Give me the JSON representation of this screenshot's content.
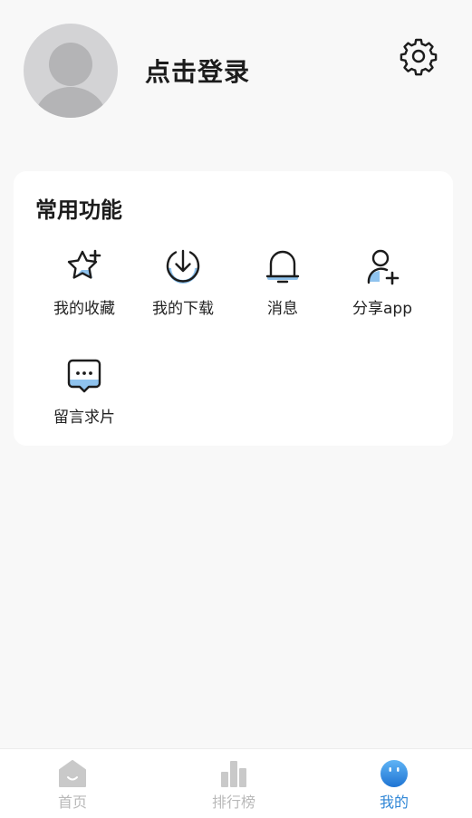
{
  "header": {
    "login_text": "点击登录",
    "avatar_icon": "user-avatar-placeholder",
    "settings_icon": "gear-icon"
  },
  "functions": {
    "title": "常用功能",
    "items": [
      {
        "label": "我的收藏",
        "icon": "star-plus-icon"
      },
      {
        "label": "我的下载",
        "icon": "download-icon"
      },
      {
        "label": "消息",
        "icon": "bell-icon"
      },
      {
        "label": "分享app",
        "icon": "user-add-icon"
      },
      {
        "label": "留言求片",
        "icon": "chat-bubble-icon"
      }
    ]
  },
  "tabbar": {
    "items": [
      {
        "label": "首页",
        "icon": "home-icon",
        "active": false
      },
      {
        "label": "排行榜",
        "icon": "ranking-icon",
        "active": false
      },
      {
        "label": "我的",
        "icon": "profile-face-icon",
        "active": true
      }
    ]
  },
  "colors": {
    "accent": "#2f86d6",
    "accent_light": "#8fc3ee",
    "inactive_tab": "#b9b9b9",
    "avatar_bg": "#d3d3d5"
  }
}
